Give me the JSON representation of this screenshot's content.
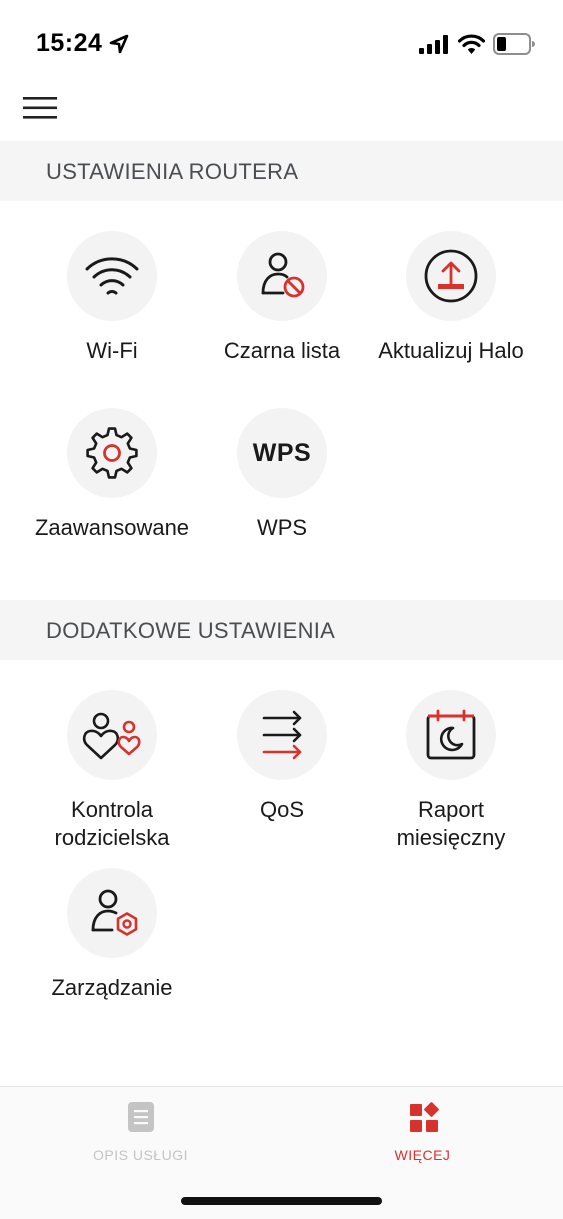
{
  "status_bar": {
    "time": "15:24",
    "location_icon": "location-arrow-icon",
    "signal_icon": "cellular-signal-icon",
    "wifi_icon": "wifi-status-icon",
    "battery_icon": "battery-icon"
  },
  "header": {
    "menu_icon": "hamburger-menu-icon"
  },
  "sections": {
    "router": {
      "title": "USTAWIENIA ROUTERA",
      "items": [
        {
          "label": "Wi-Fi",
          "icon": "wifi-icon"
        },
        {
          "label": "Czarna lista",
          "icon": "user-blocked-icon"
        },
        {
          "label": "Aktualizuj Halo",
          "icon": "upload-update-icon"
        },
        {
          "label": "Zaawansowane",
          "icon": "gear-icon"
        },
        {
          "label": "WPS",
          "icon": "wps-icon",
          "icon_text": "WPS"
        }
      ]
    },
    "additional": {
      "title": "DODATKOWE USTAWIENIA",
      "items": [
        {
          "label": "Kontrola rodzicielska",
          "icon": "parental-control-icon"
        },
        {
          "label": "QoS",
          "icon": "qos-arrows-icon"
        },
        {
          "label": "Raport miesięczny",
          "icon": "monthly-report-calendar-icon"
        },
        {
          "label": "Zarządzanie",
          "icon": "user-admin-icon"
        }
      ]
    }
  },
  "tabbar": {
    "tabs": [
      {
        "label": "OPIS USŁUGI",
        "icon": "document-icon",
        "active": false
      },
      {
        "label": "WIĘCEJ",
        "icon": "more-apps-icon",
        "active": true
      }
    ]
  },
  "colors": {
    "accent": "#d8322d",
    "icon_dark": "#1a1a1a",
    "section_bg": "#f5f5f5",
    "circle_bg": "#f3f3f3",
    "section_text": "#4a4d52",
    "inactive_tab": "#c4c4c4"
  }
}
